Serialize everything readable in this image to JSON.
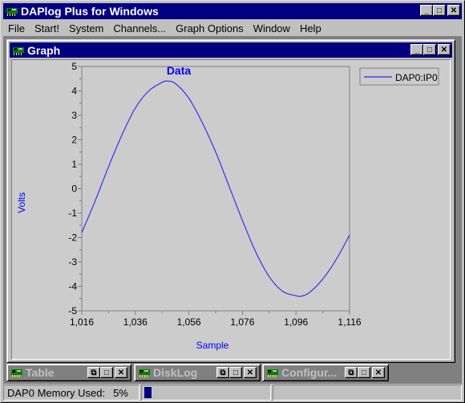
{
  "app": {
    "title": "DAPlog Plus for Windows",
    "icon": "circuit-board-icon"
  },
  "menu": [
    "File",
    "Start!",
    "System",
    "Channels...",
    "Graph Options",
    "Window",
    "Help"
  ],
  "window_buttons": {
    "minimize": "_",
    "maximize": "□",
    "close": "✕",
    "restore": "⧉"
  },
  "graph_window": {
    "title": "Graph"
  },
  "minimized_windows": [
    {
      "title": "Table"
    },
    {
      "title": "DiskLog"
    },
    {
      "title": "Configur..."
    }
  ],
  "status": {
    "memory_label": "DAP0 Memory Used:",
    "memory_value": "5%",
    "memory_fraction": 0.05,
    "accent": "#000080"
  },
  "chart_data": {
    "type": "line",
    "title": "Data",
    "xlabel": "Sample",
    "ylabel": "Volts",
    "xlim": [
      1016,
      1116
    ],
    "ylim": [
      -5,
      5
    ],
    "x_ticks": [
      1016,
      1036,
      1056,
      1076,
      1096,
      1116
    ],
    "x_tick_labels": [
      "1,016",
      "1,036",
      "1,056",
      "1,076",
      "1,096",
      "1,116"
    ],
    "y_ticks": [
      5,
      4,
      3,
      2,
      1,
      0,
      -1,
      -2,
      -3,
      -4,
      -5
    ],
    "y_tick_labels": [
      "5",
      "4",
      "3",
      "2",
      "1",
      "0",
      "-1",
      "-2",
      "-3",
      "-4",
      "-5"
    ],
    "grid": false,
    "legend": {
      "position": "top-right",
      "entries": [
        "DAP0:IP0"
      ]
    },
    "series": [
      {
        "name": "DAP0:IP0",
        "color": "#3333ee",
        "x": [
          1016,
          1021,
          1026,
          1031,
          1036,
          1041,
          1046,
          1048,
          1051,
          1056,
          1061,
          1066,
          1071,
          1076,
          1081,
          1086,
          1091,
          1096,
          1098,
          1101,
          1106,
          1111,
          1116
        ],
        "y": [
          -1.8,
          -0.5,
          0.9,
          2.2,
          3.3,
          4.0,
          4.35,
          4.4,
          4.3,
          3.7,
          2.7,
          1.5,
          0.1,
          -1.3,
          -2.6,
          -3.6,
          -4.2,
          -4.38,
          -4.4,
          -4.25,
          -3.7,
          -2.9,
          -1.9
        ]
      }
    ]
  }
}
